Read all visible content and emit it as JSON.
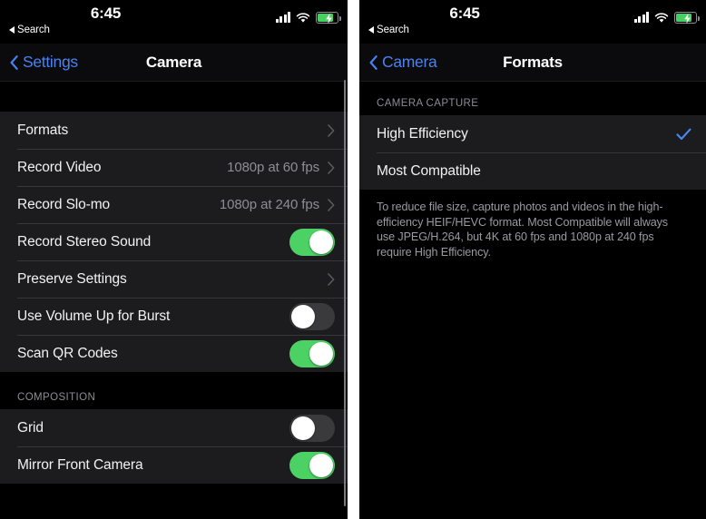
{
  "status_bar": {
    "time": "6:45",
    "back_label": "Search",
    "back_icon": "triangle-left-icon",
    "cellular_icon": "cellular-bars-icon",
    "wifi_icon": "wifi-icon",
    "battery_icon": "battery-charging-icon"
  },
  "colors": {
    "accent_blue": "#4a82f0",
    "toggle_on_green": "#4cd264",
    "toggle_off_gray": "#3a3a3d",
    "row_background": "#1c1c1e",
    "page_background": "#000000",
    "secondary_text": "#8d8d93",
    "separator": "#37373a"
  },
  "left_panel": {
    "nav": {
      "back_label": "Settings",
      "back_icon": "chevron-left-icon",
      "title": "Camera"
    },
    "sections": [
      {
        "header": "",
        "rows": [
          {
            "label": "Formats",
            "type": "disclosure",
            "value": ""
          },
          {
            "label": "Record Video",
            "type": "disclosure",
            "value": "1080p at 60 fps"
          },
          {
            "label": "Record Slo-mo",
            "type": "disclosure",
            "value": "1080p at 240 fps"
          },
          {
            "label": "Record Stereo Sound",
            "type": "toggle",
            "state": "on"
          },
          {
            "label": "Preserve Settings",
            "type": "disclosure",
            "value": ""
          },
          {
            "label": "Use Volume Up for Burst",
            "type": "toggle",
            "state": "off"
          },
          {
            "label": "Scan QR Codes",
            "type": "toggle",
            "state": "on"
          }
        ]
      },
      {
        "header": "COMPOSITION",
        "rows": [
          {
            "label": "Grid",
            "type": "toggle",
            "state": "off"
          },
          {
            "label": "Mirror Front Camera",
            "type": "toggle",
            "state": "on"
          }
        ]
      }
    ]
  },
  "right_panel": {
    "nav": {
      "back_label": "Camera",
      "back_icon": "chevron-left-icon",
      "title": "Formats"
    },
    "section_header": "CAMERA CAPTURE",
    "options": [
      {
        "label": "High Efficiency",
        "selected": true
      },
      {
        "label": "Most Compatible",
        "selected": false
      }
    ],
    "footnote": "To reduce file size, capture photos and videos in the high-efficiency HEIF/HEVC format. Most Compatible will always use JPEG/H.264, but 4K at 60 fps and 1080p at 240 fps require High Efficiency."
  }
}
